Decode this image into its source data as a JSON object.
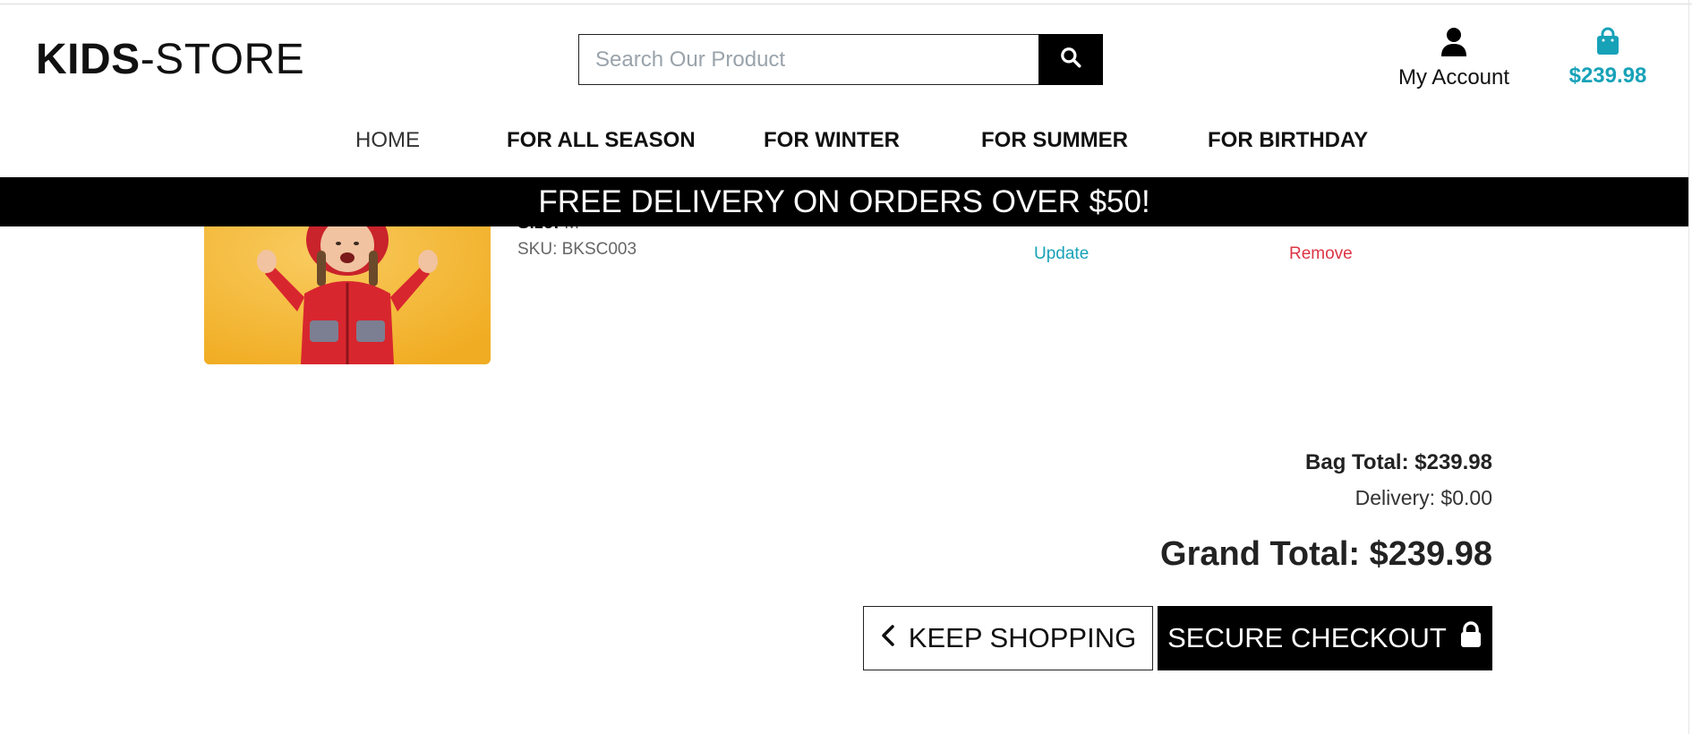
{
  "header": {
    "logo_bold": "KIDS",
    "logo_rest": "-STORE",
    "search_placeholder": "Search Our Product",
    "account_label": "My Account",
    "bag_amount": "$239.98"
  },
  "nav": {
    "items": [
      {
        "label": "HOME"
      },
      {
        "label": "FOR ALL SEASON"
      },
      {
        "label": "FOR WINTER"
      },
      {
        "label": "FOR SUMMER"
      },
      {
        "label": "FOR BIRTHDAY"
      }
    ]
  },
  "banner": {
    "text": "FREE DELIVERY ON ORDERS OVER $50!"
  },
  "cart_item": {
    "size_label": "Size:",
    "size_value": "M",
    "sku": "SKU: BKSC003",
    "update_label": "Update",
    "remove_label": "Remove"
  },
  "summary": {
    "bag_total": "Bag Total: $239.98",
    "delivery": "Delivery: $0.00",
    "grand_total": "Grand Total: $239.98"
  },
  "buttons": {
    "keep_shopping": "KEEP SHOPPING",
    "secure_checkout": "SECURE CHECKOUT"
  },
  "colors": {
    "accent": "#17a2b8",
    "danger": "#dc3545",
    "banner_bg": "#000000"
  },
  "icons": {
    "search": "search-icon",
    "account": "user-icon",
    "bag": "shopping-bag-icon",
    "back": "chevron-left-icon",
    "lock": "lock-icon"
  }
}
